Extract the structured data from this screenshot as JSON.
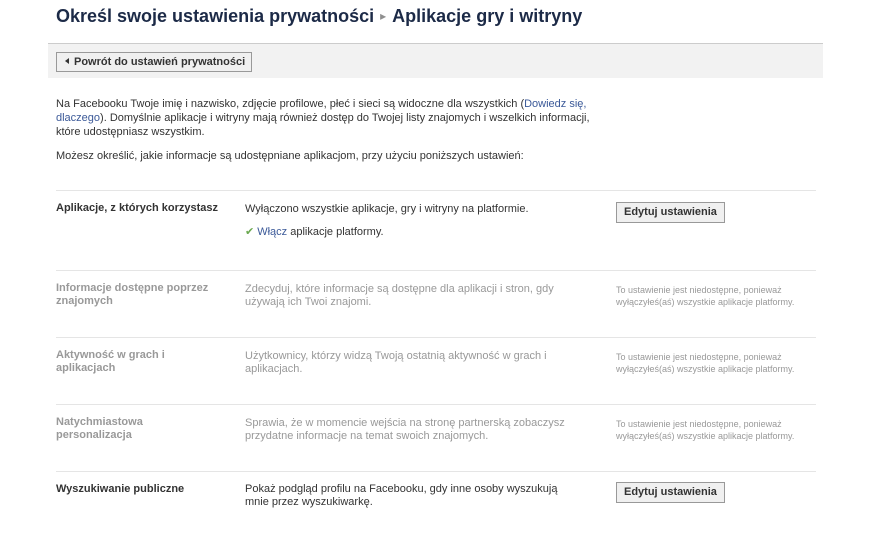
{
  "header": {
    "title_main": "Określ swoje ustawienia prywatności",
    "separator": "▸",
    "title_sub": "Aplikacje gry i witryny"
  },
  "toolbar": {
    "back_label": "Powrót do ustawień prywatności"
  },
  "intro": {
    "p1_part1": "Na Facebooku Twoje imię i nazwisko, zdjęcie profilowe, płeć i sieci są widoczne dla wszystkich (",
    "p1_link": "Dowiedz się, dlaczego",
    "p1_part2": "). Domyślnie aplikacje i witryny mają również dostęp do Twojej listy znajomych i wszelkich informacji, które udostępniasz wszystkim.",
    "p2": "Możesz określić, jakie informacje są udostępniane aplikacjom, przy użyciu poniższych ustawień:"
  },
  "rows": [
    {
      "label": "Aplikacje, z których korzystasz",
      "desc": "Wyłączono wszystkie aplikacje, gry i witryny na platformie.",
      "enable_link": "Włącz",
      "enable_rest": " aplikacje platformy.",
      "button": "Edytuj ustawienia"
    },
    {
      "label": "Informacje dostępne poprzez znajomych",
      "desc": "Zdecyduj, które informacje są dostępne dla aplikacji i stron, gdy używają ich Twoi znajomi.",
      "note": "To ustawienie jest niedostępne, ponieważ wyłączyłeś(aś) wszystkie aplikacje platformy."
    },
    {
      "label": "Aktywność w grach i aplikacjach",
      "desc": "Użytkownicy, którzy widzą Twoją ostatnią aktywność w grach i aplikacjach.",
      "note": "To ustawienie jest niedostępne, ponieważ wyłączyłeś(aś) wszystkie aplikacje platformy."
    },
    {
      "label": "Natychmiastowa personalizacja",
      "desc": "Sprawia, że w momencie wejścia na stronę partnerską zobaczysz przydatne informacje na temat swoich znajomych.",
      "note": "To ustawienie jest niedostępne, ponieważ wyłączyłeś(aś) wszystkie aplikacje platformy."
    },
    {
      "label": "Wyszukiwanie publiczne",
      "desc": "Pokaż podgląd profilu na Facebooku, gdy inne osoby wyszukują mnie przez wyszukiwarkę.",
      "button": "Edytuj ustawienia"
    }
  ]
}
